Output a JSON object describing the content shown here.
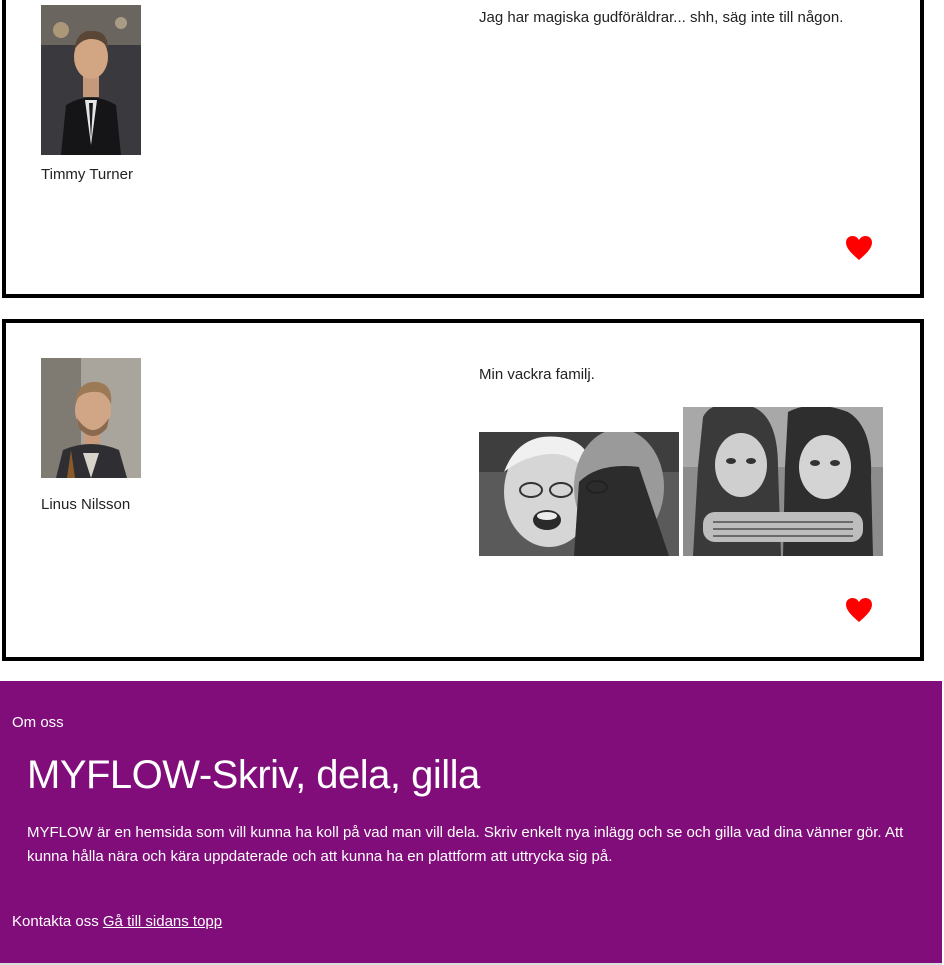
{
  "posts": [
    {
      "author": "Timmy Turner",
      "text": "Jag har magiska gudföräldrar... shh, säg inte till någon.",
      "avatar_desc": "man-in-suit-avatar",
      "like_color": "#ff0000"
    },
    {
      "author": "Linus Nilsson",
      "text": "Min vackra familj.",
      "avatar_desc": "bearded-man-avatar",
      "photos": [
        "elderly-couple-photo",
        "twin-girls-photo"
      ],
      "like_color": "#ff0000"
    }
  ],
  "footer": {
    "about_label": "Om oss",
    "heading": "MYFLOW-Skriv, dela, gilla",
    "description": "MYFLOW är en hemsida som vill kunna ha koll på vad man vill dela. Skriv enkelt nya inlägg och se och gilla vad dina vänner gör. Att kunna hålla nära och kära uppdaterade och att kunna ha en plattform att uttrycka sig på.",
    "contact_label": "Kontakta oss",
    "top_link": "Gå till sidans topp",
    "background": "#810d7b"
  }
}
